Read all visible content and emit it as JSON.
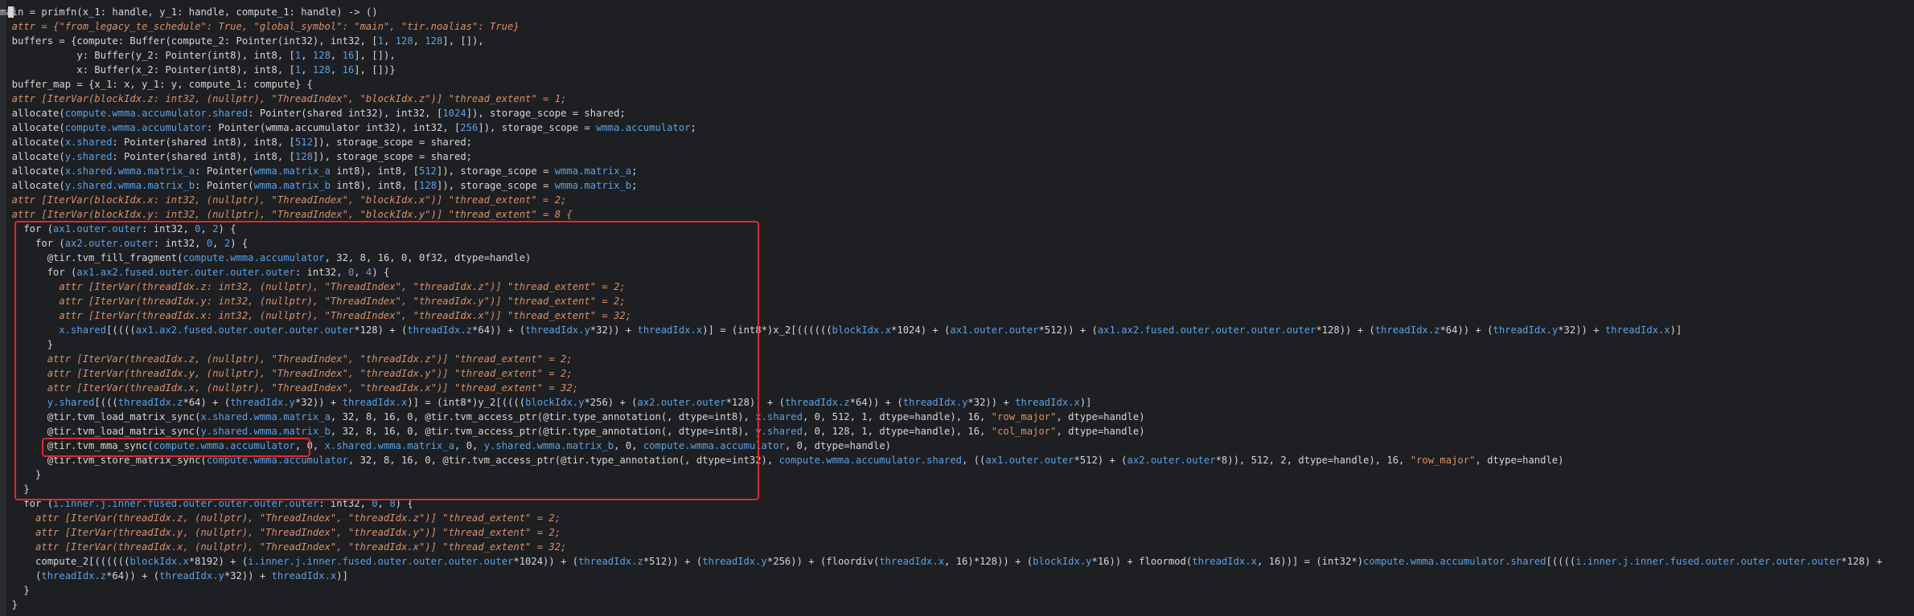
{
  "editor": {
    "lines": [
      [
        {
          "t": "main = primfn(x_1: handle, y_1: handle, compute_1: handle) -> ()",
          "c": "k"
        }
      ],
      [
        {
          "t": "  attr = {\"from_legacy_te_schedule\": True, \"global_symbol\": \"main\", \"tir.noalias\": True}",
          "c": "a"
        }
      ],
      [
        {
          "t": "  buffers = {compute: Buffer(compute_2: Pointer(int32), int32, [",
          "c": "k"
        },
        {
          "t": "1",
          "c": "b"
        },
        {
          "t": ", ",
          "c": "k"
        },
        {
          "t": "128",
          "c": "b"
        },
        {
          "t": ", ",
          "c": "k"
        },
        {
          "t": "128",
          "c": "b"
        },
        {
          "t": "], []),",
          "c": "k"
        }
      ],
      [
        {
          "t": "             y: Buffer(y_2: Pointer(int8), int8, [",
          "c": "k"
        },
        {
          "t": "1",
          "c": "b"
        },
        {
          "t": ", ",
          "c": "k"
        },
        {
          "t": "128",
          "c": "b"
        },
        {
          "t": ", ",
          "c": "k"
        },
        {
          "t": "16",
          "c": "b"
        },
        {
          "t": "], []),",
          "c": "k"
        }
      ],
      [
        {
          "t": "             x: Buffer(x_2: Pointer(int8), int8, [",
          "c": "k"
        },
        {
          "t": "1",
          "c": "b"
        },
        {
          "t": ", ",
          "c": "k"
        },
        {
          "t": "128",
          "c": "b"
        },
        {
          "t": ", ",
          "c": "k"
        },
        {
          "t": "16",
          "c": "b"
        },
        {
          "t": "], [])}",
          "c": "k"
        }
      ],
      [
        {
          "t": "  buffer_map = {x_1: x, y_1: y, compute_1: compute} {",
          "c": "k"
        }
      ],
      [
        {
          "t": "  attr [IterVar(blockIdx.z: int32, (nullptr), \"ThreadIndex\", \"blockIdx.z\")] \"thread_extent\" = 1;",
          "c": "a"
        }
      ],
      [
        {
          "t": "  allocate(",
          "c": "k"
        },
        {
          "t": "compute.wmma.accumulator.shared",
          "c": "b"
        },
        {
          "t": ": Pointer(shared int32), int32, [",
          "c": "k"
        },
        {
          "t": "1024",
          "c": "b"
        },
        {
          "t": "]), storage_scope = shared;",
          "c": "k"
        }
      ],
      [
        {
          "t": "  allocate(",
          "c": "k"
        },
        {
          "t": "compute.wmma.accumulator",
          "c": "b"
        },
        {
          "t": ": Pointer(wmma.accumulator int32), int32, [",
          "c": "k"
        },
        {
          "t": "256",
          "c": "b"
        },
        {
          "t": "]), storage_scope = ",
          "c": "k"
        },
        {
          "t": "wmma.accumulator",
          "c": "b"
        },
        {
          "t": ";",
          "c": "k"
        }
      ],
      [
        {
          "t": "  allocate(",
          "c": "k"
        },
        {
          "t": "x.shared",
          "c": "b"
        },
        {
          "t": ": Pointer(shared int8), int8, [",
          "c": "k"
        },
        {
          "t": "512",
          "c": "b"
        },
        {
          "t": "]), storage_scope = shared;",
          "c": "k"
        }
      ],
      [
        {
          "t": "  allocate(",
          "c": "k"
        },
        {
          "t": "y.shared",
          "c": "b"
        },
        {
          "t": ": Pointer(shared int8), int8, [",
          "c": "k"
        },
        {
          "t": "128",
          "c": "b"
        },
        {
          "t": "]), storage_scope = shared;",
          "c": "k"
        }
      ],
      [
        {
          "t": "  allocate(",
          "c": "k"
        },
        {
          "t": "x.shared.wmma.matrix_a",
          "c": "b"
        },
        {
          "t": ": Pointer(",
          "c": "k"
        },
        {
          "t": "wmma.matrix_a",
          "c": "b"
        },
        {
          "t": " int8), int8, [",
          "c": "k"
        },
        {
          "t": "512",
          "c": "b"
        },
        {
          "t": "]), storage_scope = ",
          "c": "k"
        },
        {
          "t": "wmma.matrix_a",
          "c": "b"
        },
        {
          "t": ";",
          "c": "k"
        }
      ],
      [
        {
          "t": "  allocate(",
          "c": "k"
        },
        {
          "t": "y.shared.wmma.matrix_b",
          "c": "b"
        },
        {
          "t": ": Pointer(",
          "c": "k"
        },
        {
          "t": "wmma.matrix_b",
          "c": "b"
        },
        {
          "t": " int8), int8, [",
          "c": "k"
        },
        {
          "t": "128",
          "c": "b"
        },
        {
          "t": "]), storage_scope = ",
          "c": "k"
        },
        {
          "t": "wmma.matrix_b",
          "c": "b"
        },
        {
          "t": ";",
          "c": "k"
        }
      ],
      [
        {
          "t": "  attr [IterVar(blockIdx.x: int32, (nullptr), \"ThreadIndex\", \"blockIdx.x\")] \"thread_extent\" = 2;",
          "c": "a"
        }
      ],
      [
        {
          "t": "  attr [IterVar(blockIdx.y: int32, (nullptr), \"ThreadIndex\", \"blockIdx.y\")] \"thread_extent\" = 8 {",
          "c": "a"
        }
      ],
      [
        {
          "t": "    for (",
          "c": "k"
        },
        {
          "t": "ax1.outer.outer",
          "c": "b"
        },
        {
          "t": ": int32, ",
          "c": "k"
        },
        {
          "t": "0",
          "c": "b"
        },
        {
          "t": ", ",
          "c": "k"
        },
        {
          "t": "2",
          "c": "b"
        },
        {
          "t": ") {",
          "c": "k"
        }
      ],
      [
        {
          "t": "      for (",
          "c": "k"
        },
        {
          "t": "ax2.outer.outer",
          "c": "b"
        },
        {
          "t": ": int32, ",
          "c": "k"
        },
        {
          "t": "0",
          "c": "b"
        },
        {
          "t": ", ",
          "c": "k"
        },
        {
          "t": "2",
          "c": "b"
        },
        {
          "t": ") {",
          "c": "k"
        }
      ],
      [
        {
          "t": "        @tir.tvm_fill_fragment(",
          "c": "k"
        },
        {
          "t": "compute.wmma.accumulator",
          "c": "b"
        },
        {
          "t": ", 32, 8, 16, 0, 0f32, dtype=handle)",
          "c": "k"
        }
      ],
      [
        {
          "t": "        for (",
          "c": "k"
        },
        {
          "t": "ax1.ax2.fused.outer.outer.outer.outer",
          "c": "b"
        },
        {
          "t": ": int32, ",
          "c": "k"
        },
        {
          "t": "0",
          "c": "b"
        },
        {
          "t": ", ",
          "c": "k"
        },
        {
          "t": "4",
          "c": "b"
        },
        {
          "t": ") {",
          "c": "k"
        }
      ],
      [
        {
          "t": "          attr [IterVar(threadIdx.z: int32, (nullptr), \"ThreadIndex\", \"threadIdx.z\")] \"thread_extent\" = 2;",
          "c": "a"
        }
      ],
      [
        {
          "t": "          attr [IterVar(threadIdx.y: int32, (nullptr), \"ThreadIndex\", \"threadIdx.y\")] \"thread_extent\" = 2;",
          "c": "a"
        }
      ],
      [
        {
          "t": "          attr [IterVar(threadIdx.x: int32, (nullptr), \"ThreadIndex\", \"threadIdx.x\")] \"thread_extent\" = 32;",
          "c": "a"
        }
      ],
      [
        {
          "t": "          ",
          "c": "k"
        },
        {
          "t": "x.shared",
          "c": "b"
        },
        {
          "t": "[((((",
          "c": "k"
        },
        {
          "t": "ax1.ax2.fused.outer.outer.outer.outer",
          "c": "b"
        },
        {
          "t": "*128) + (",
          "c": "k"
        },
        {
          "t": "threadIdx.z",
          "c": "b"
        },
        {
          "t": "*64)) + (",
          "c": "k"
        },
        {
          "t": "threadIdx.y",
          "c": "b"
        },
        {
          "t": "*32)) + ",
          "c": "k"
        },
        {
          "t": "threadIdx.x",
          "c": "b"
        },
        {
          "t": ")] = (int8*)x_2[((((((",
          "c": "k"
        },
        {
          "t": "blockIdx.x",
          "c": "b"
        },
        {
          "t": "*1024) + (",
          "c": "k"
        },
        {
          "t": "ax1.outer.outer",
          "c": "b"
        },
        {
          "t": "*512)) + (",
          "c": "k"
        },
        {
          "t": "ax1.ax2.fused.outer.outer.outer.outer",
          "c": "b"
        },
        {
          "t": "*128)) + (",
          "c": "k"
        },
        {
          "t": "threadIdx.z",
          "c": "b"
        },
        {
          "t": "*64)) + (",
          "c": "k"
        },
        {
          "t": "threadIdx.y",
          "c": "b"
        },
        {
          "t": "*32)) + ",
          "c": "k"
        },
        {
          "t": "threadIdx.x",
          "c": "b"
        },
        {
          "t": ")]",
          "c": "k"
        }
      ],
      [
        {
          "t": "        }",
          "c": "k"
        }
      ],
      [
        {
          "t": "        attr [IterVar(threadIdx.z, (nullptr), \"ThreadIndex\", \"threadIdx.z\")] \"thread_extent\" = 2;",
          "c": "a"
        }
      ],
      [
        {
          "t": "        attr [IterVar(threadIdx.y, (nullptr), \"ThreadIndex\", \"threadIdx.y\")] \"thread_extent\" = 2;",
          "c": "a"
        }
      ],
      [
        {
          "t": "        attr [IterVar(threadIdx.x, (nullptr), \"ThreadIndex\", \"threadIdx.x\")] \"thread_extent\" = 32;",
          "c": "a"
        }
      ],
      [
        {
          "t": "        ",
          "c": "k"
        },
        {
          "t": "y.shared",
          "c": "b"
        },
        {
          "t": "[(((",
          "c": "k"
        },
        {
          "t": "threadIdx.z",
          "c": "b"
        },
        {
          "t": "*64) + (",
          "c": "k"
        },
        {
          "t": "threadIdx.y",
          "c": "b"
        },
        {
          "t": "*32)) + ",
          "c": "k"
        },
        {
          "t": "threadIdx.x",
          "c": "b"
        },
        {
          "t": ")] = (int8*)y_2[((((",
          "c": "k"
        },
        {
          "t": "blockIdx.y",
          "c": "b"
        },
        {
          "t": "*256) + (",
          "c": "k"
        },
        {
          "t": "ax2.outer.outer",
          "c": "b"
        },
        {
          "t": "*128)) + (",
          "c": "k"
        },
        {
          "t": "threadIdx.z",
          "c": "b"
        },
        {
          "t": "*64)) + (",
          "c": "k"
        },
        {
          "t": "threadIdx.y",
          "c": "b"
        },
        {
          "t": "*32)) + ",
          "c": "k"
        },
        {
          "t": "threadIdx.x",
          "c": "b"
        },
        {
          "t": ")]",
          "c": "k"
        }
      ],
      [
        {
          "t": "        @tir.tvm_load_matrix_sync(",
          "c": "k"
        },
        {
          "t": "x.shared.wmma.matrix_a",
          "c": "b"
        },
        {
          "t": ", 32, 8, 16, 0, @tir.tvm_access_ptr(@tir.type_annotation(, dtype=int8), ",
          "c": "k"
        },
        {
          "t": "x.shared",
          "c": "b"
        },
        {
          "t": ", 0, 512, 1, dtype=handle), 16, ",
          "c": "k"
        },
        {
          "t": "\"row_major\"",
          "c": "s"
        },
        {
          "t": ", dtype=handle)",
          "c": "k"
        }
      ],
      [
        {
          "t": "        @tir.tvm_load_matrix_sync(",
          "c": "k"
        },
        {
          "t": "y.shared.wmma.matrix_b",
          "c": "b"
        },
        {
          "t": ", 32, 8, 16, 0, @tir.tvm_access_ptr(@tir.type_annotation(, dtype=int8), ",
          "c": "k"
        },
        {
          "t": "y.shared",
          "c": "b"
        },
        {
          "t": ", 0, 128, 1, dtype=handle), 16, ",
          "c": "k"
        },
        {
          "t": "\"col_major\"",
          "c": "s"
        },
        {
          "t": ", dtype=handle)",
          "c": "k"
        }
      ],
      [
        {
          "t": "        @tir.tvm_mma_sync(",
          "c": "k"
        },
        {
          "t": "compute.wmma.accumulator",
          "c": "b"
        },
        {
          "t": ", 0, ",
          "c": "k"
        },
        {
          "t": "x.shared.wmma.matrix_a",
          "c": "b"
        },
        {
          "t": ", 0, ",
          "c": "k"
        },
        {
          "t": "y.shared.wmma.matrix_b",
          "c": "b"
        },
        {
          "t": ", 0, ",
          "c": "k"
        },
        {
          "t": "compute.wmma.accumulator",
          "c": "b"
        },
        {
          "t": ", 0, dtype=handle)",
          "c": "k"
        }
      ],
      [
        {
          "t": "        @tir.tvm_store_matrix_sync(",
          "c": "k"
        },
        {
          "t": "compute.wmma.accumulator",
          "c": "b"
        },
        {
          "t": ", 32, 8, 16, 0, @tir.tvm_access_ptr(@tir.type_annotation(, dtype=int32), ",
          "c": "k"
        },
        {
          "t": "compute.wmma.accumulator.shared",
          "c": "b"
        },
        {
          "t": ", ((",
          "c": "k"
        },
        {
          "t": "ax1.outer.outer",
          "c": "b"
        },
        {
          "t": "*512) + (",
          "c": "k"
        },
        {
          "t": "ax2.outer.outer",
          "c": "b"
        },
        {
          "t": "*8)), 512, 2, dtype=handle), 16, ",
          "c": "k"
        },
        {
          "t": "\"row_major\"",
          "c": "s"
        },
        {
          "t": ", dtype=handle)",
          "c": "k"
        }
      ],
      [
        {
          "t": "      }",
          "c": "k"
        }
      ],
      [
        {
          "t": "    }",
          "c": "k"
        }
      ],
      [
        {
          "t": "    for (",
          "c": "k"
        },
        {
          "t": "i.inner.j.inner.fused.outer.outer.outer.outer",
          "c": "b"
        },
        {
          "t": ": int32, ",
          "c": "k"
        },
        {
          "t": "0",
          "c": "b"
        },
        {
          "t": ", ",
          "c": "k"
        },
        {
          "t": "8",
          "c": "b"
        },
        {
          "t": ") {",
          "c": "k"
        }
      ],
      [
        {
          "t": "      attr [IterVar(threadIdx.z, (nullptr), \"ThreadIndex\", \"threadIdx.z\")] \"thread_extent\" = 2;",
          "c": "a"
        }
      ],
      [
        {
          "t": "      attr [IterVar(threadIdx.y, (nullptr), \"ThreadIndex\", \"threadIdx.y\")] \"thread_extent\" = 2;",
          "c": "a"
        }
      ],
      [
        {
          "t": "      attr [IterVar(threadIdx.x, (nullptr), \"ThreadIndex\", \"threadIdx.x\")] \"thread_extent\" = 32;",
          "c": "a"
        }
      ],
      [
        {
          "t": "      compute_2[((((((",
          "c": "k"
        },
        {
          "t": "blockIdx.x",
          "c": "b"
        },
        {
          "t": "*8192) + (",
          "c": "k"
        },
        {
          "t": "i.inner.j.inner.fused.outer.outer.outer.outer",
          "c": "b"
        },
        {
          "t": "*1024)) + (",
          "c": "k"
        },
        {
          "t": "threadIdx.z",
          "c": "b"
        },
        {
          "t": "*512)) + (",
          "c": "k"
        },
        {
          "t": "threadIdx.y",
          "c": "b"
        },
        {
          "t": "*256)) + (floordiv(",
          "c": "k"
        },
        {
          "t": "threadIdx.x",
          "c": "b"
        },
        {
          "t": ", 16)*128)) + (",
          "c": "k"
        },
        {
          "t": "blockIdx.y",
          "c": "b"
        },
        {
          "t": "*16)) + floormod(",
          "c": "k"
        },
        {
          "t": "threadIdx.x",
          "c": "b"
        },
        {
          "t": ", 16))] = (int32*)",
          "c": "k"
        },
        {
          "t": "compute.wmma.accumulator.shared",
          "c": "b"
        },
        {
          "t": "[((((",
          "c": "k"
        },
        {
          "t": "i.inner.j.inner.fused.outer.outer.outer.outer",
          "c": "b"
        },
        {
          "t": "*128) +",
          "c": "k"
        }
      ],
      [
        {
          "t": "      (",
          "c": "k"
        },
        {
          "t": "threadIdx.z",
          "c": "b"
        },
        {
          "t": "*64)) + (",
          "c": "k"
        },
        {
          "t": "threadIdx.y",
          "c": "b"
        },
        {
          "t": "*32)) + ",
          "c": "k"
        },
        {
          "t": "threadIdx.x",
          "c": "b"
        },
        {
          "t": ")]",
          "c": "k"
        }
      ],
      [
        {
          "t": "    }",
          "c": "k"
        }
      ],
      [
        {
          "t": "  }",
          "c": "k"
        }
      ]
    ]
  }
}
